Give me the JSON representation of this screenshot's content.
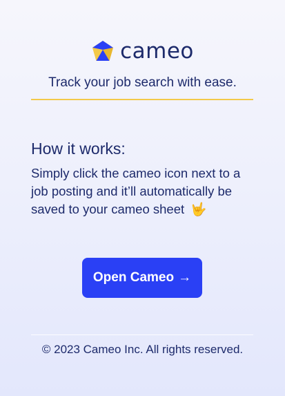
{
  "header": {
    "brand_name": "cameo",
    "logo_icon": "cameo-pentagon-logo-icon",
    "tagline": "Track your job search with ease."
  },
  "how_it_works": {
    "title": "How it works:",
    "body": "Simply click the cameo icon next to a job posting and it’ll automatically be saved to your cameo sheet",
    "emoji": "🤟",
    "emoji_icon": "love-you-gesture-icon"
  },
  "cta": {
    "label": "Open Cameo",
    "arrow": "→",
    "arrow_icon": "arrow-right-icon"
  },
  "footer": {
    "copyright": "© 2023 Cameo Inc. All rights reserved."
  },
  "colors": {
    "brand_navy": "#1d2a6b",
    "accent_yellow": "#f3c94a",
    "button_blue": "#2a40f5",
    "logo_blue": "#2a40f5"
  }
}
